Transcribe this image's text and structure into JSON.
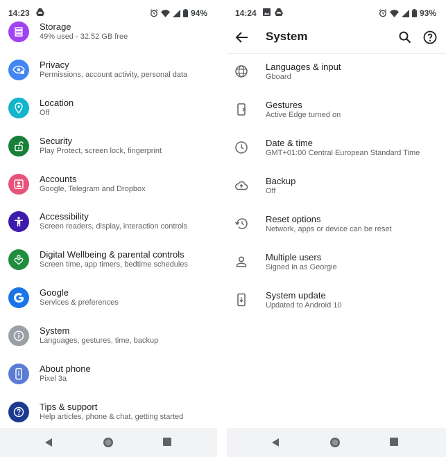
{
  "left_phone": {
    "status_bar": {
      "time": "14:23",
      "battery": "94%"
    },
    "settings_items": [
      {
        "title": "Storage",
        "subtitle": "49% used - 32.52 GB free",
        "icon": "storage-icon",
        "color": "#a142f4"
      },
      {
        "title": "Privacy",
        "subtitle": "Permissions, account activity, personal data",
        "icon": "privacy-eye-icon",
        "color": "#4285f4"
      },
      {
        "title": "Location",
        "subtitle": "Off",
        "icon": "location-pin-icon",
        "color": "#12b5cb"
      },
      {
        "title": "Security",
        "subtitle": "Play Protect, screen lock, fingerprint",
        "icon": "lock-icon",
        "color": "#188038"
      },
      {
        "title": "Accounts",
        "subtitle": "Google, Telegram and Dropbox",
        "icon": "account-box-icon",
        "color": "#e8537a"
      },
      {
        "title": "Accessibility",
        "subtitle": "Screen readers, display, interaction controls",
        "icon": "accessibility-person-icon",
        "color": "#3c1bad"
      },
      {
        "title": "Digital Wellbeing & parental controls",
        "subtitle": "Screen time, app timers, bedtime schedules",
        "icon": "wellbeing-heart-icon",
        "color": "#1e8e3e"
      },
      {
        "title": "Google",
        "subtitle": "Services & preferences",
        "icon": "google-g-icon",
        "color": "#1a73e8"
      },
      {
        "title": "System",
        "subtitle": "Languages, gestures, time, backup",
        "icon": "info-icon",
        "color": "#9aa0a6"
      },
      {
        "title": "About phone",
        "subtitle": "Pixel 3a",
        "icon": "phone-icon",
        "color": "#5b7bd5"
      },
      {
        "title": "Tips & support",
        "subtitle": "Help articles, phone & chat, getting started",
        "icon": "help-icon",
        "color": "#1a3a8f"
      }
    ]
  },
  "right_phone": {
    "status_bar": {
      "time": "14:24",
      "battery": "93%"
    },
    "app_bar": {
      "title": "System"
    },
    "system_items": [
      {
        "title": "Languages & input",
        "subtitle": "Gboard",
        "icon": "globe-icon"
      },
      {
        "title": "Gestures",
        "subtitle": "Active Edge turned on",
        "icon": "gestures-phone-icon"
      },
      {
        "title": "Date & time",
        "subtitle": "GMT+01:00 Central European Standard Time",
        "icon": "clock-icon"
      },
      {
        "title": "Backup",
        "subtitle": "Off",
        "icon": "cloud-upload-icon"
      },
      {
        "title": "Reset options",
        "subtitle": "Network, apps or device can be reset",
        "icon": "restore-icon"
      },
      {
        "title": "Multiple users",
        "subtitle": "Signed in as Georgie",
        "icon": "person-icon"
      },
      {
        "title": "System update",
        "subtitle": "Updated to Android 10",
        "icon": "system-update-icon"
      }
    ]
  }
}
